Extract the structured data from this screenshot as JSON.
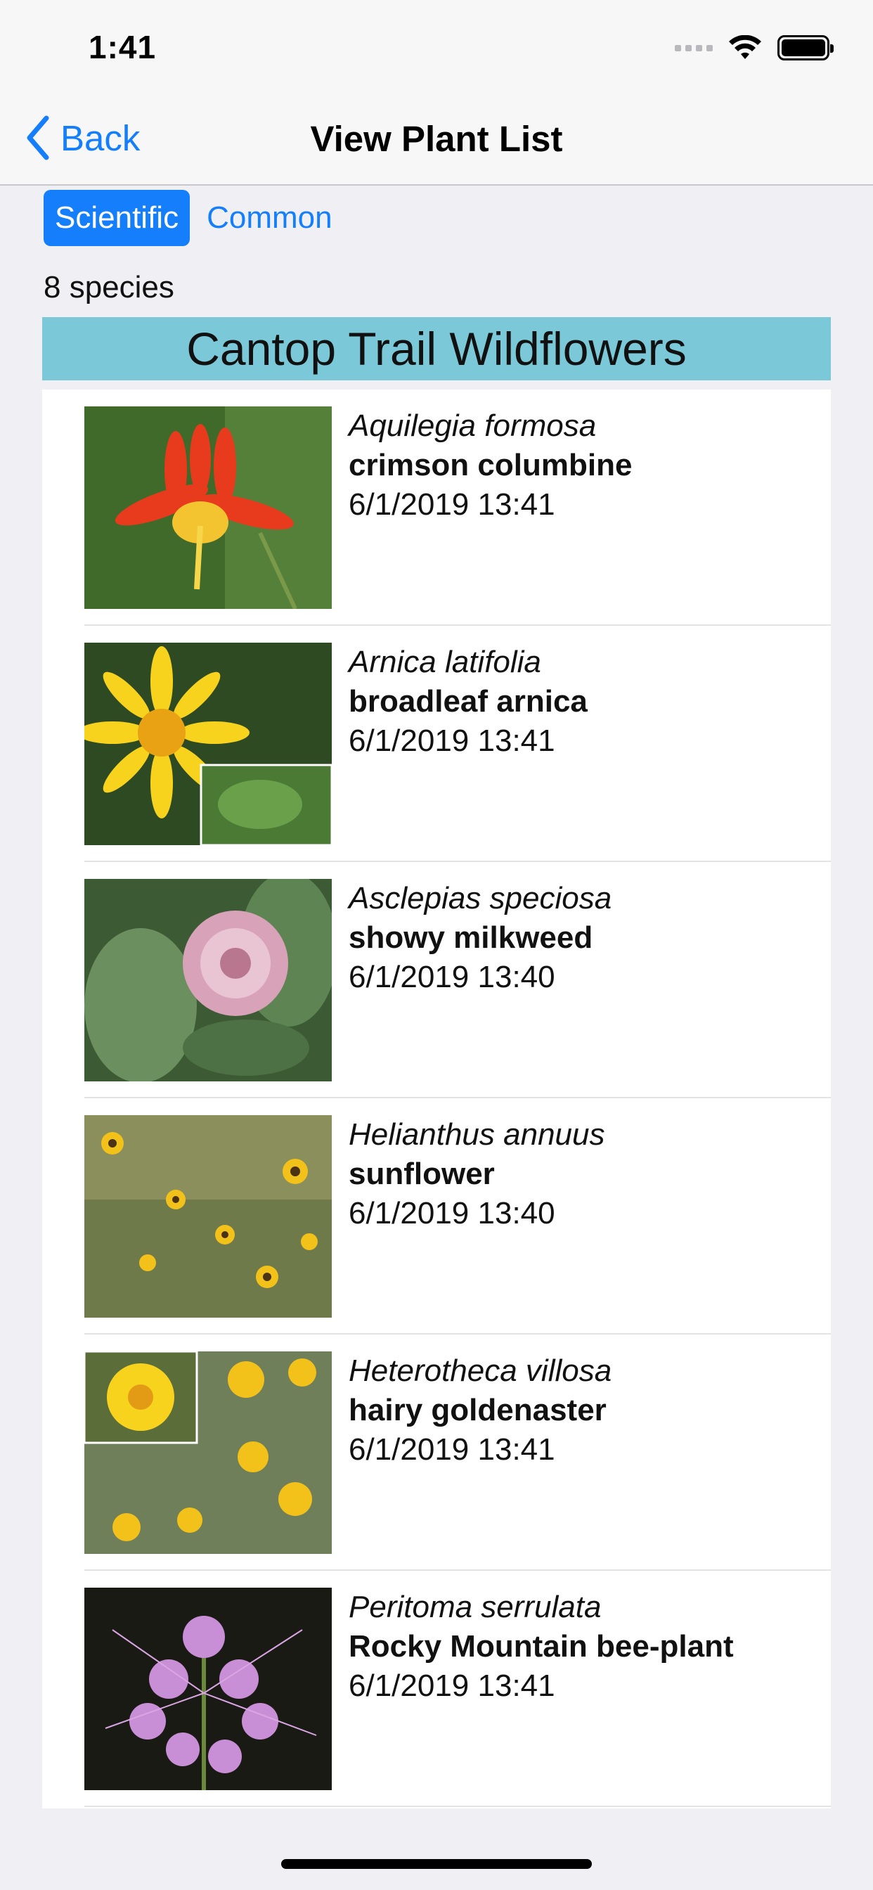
{
  "status_bar": {
    "time": "1:41"
  },
  "nav": {
    "back_label": "Back",
    "title": "View Plant List"
  },
  "segments": {
    "scientific": "Scientific",
    "common": "Common",
    "selected": "Scientific"
  },
  "species_count": "8 species",
  "list_header": "Cantop Trail Wildflowers",
  "plants": [
    {
      "scientific": "Aquilegia formosa",
      "common": "crimson columbine",
      "date": "6/1/2019 13:41",
      "thumb_icon": "red-columbine-flower-photo"
    },
    {
      "scientific": "Arnica latifolia",
      "common": "broadleaf arnica",
      "date": "6/1/2019 13:41",
      "thumb_icon": "yellow-arnica-flower-photo"
    },
    {
      "scientific": "Asclepias speciosa",
      "common": "showy milkweed",
      "date": "6/1/2019 13:40",
      "thumb_icon": "pink-milkweed-flower-photo"
    },
    {
      "scientific": "Helianthus annuus",
      "common": "sunflower",
      "date": "6/1/2019 13:40",
      "thumb_icon": "sunflower-field-photo"
    },
    {
      "scientific": "Heterotheca villosa",
      "common": "hairy goldenaster",
      "date": "6/1/2019 13:41",
      "thumb_icon": "goldenaster-flower-photo"
    },
    {
      "scientific": "Peritoma serrulata",
      "common": "Rocky Mountain bee-plant",
      "date": "6/1/2019 13:41",
      "thumb_icon": "purple-beeplant-flower-photo"
    }
  ],
  "colors": {
    "accent": "#147efb",
    "header_band": "#7ac8d8",
    "background": "#efeff4"
  }
}
